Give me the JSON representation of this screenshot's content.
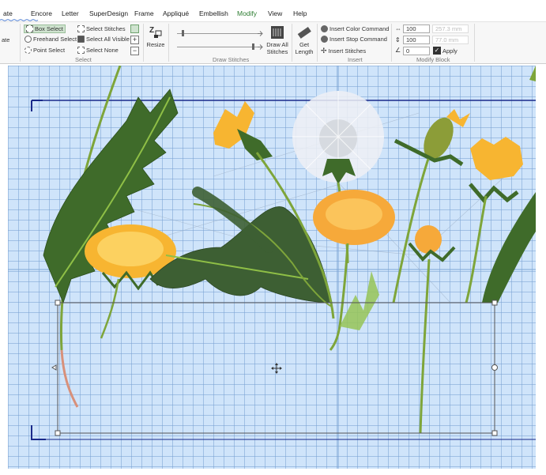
{
  "tabs": [
    {
      "label": "ate",
      "active": false
    },
    {
      "label": "Encore",
      "active": false
    },
    {
      "label": "Letter",
      "active": false
    },
    {
      "label": "SuperDesign",
      "active": false
    },
    {
      "label": "Frame",
      "active": false
    },
    {
      "label": "Appliqué",
      "active": false
    },
    {
      "label": "Embellish",
      "active": false
    },
    {
      "label": "Modify",
      "active": true
    },
    {
      "label": "View",
      "active": false
    },
    {
      "label": "Help",
      "active": false
    }
  ],
  "ribbon": {
    "left_partial_label": "ate",
    "select": {
      "box_select": "Box Select",
      "freehand_select": "Freehand Select",
      "point_select": "Point Select",
      "select_stitches": "Select Stitches",
      "select_all_visible": "Select All Visible",
      "select_none": "Select None",
      "group_label": "Select"
    },
    "resize": {
      "label": "Resize"
    },
    "draw_stitches": {
      "draw_all_label": "Draw All Stitches",
      "group_label": "Draw Stitches"
    },
    "get_length": {
      "label": "Get Length"
    },
    "insert": {
      "insert_color_command": "Insert Color Command",
      "insert_stop_command": "Insert Stop Command",
      "insert_stitches": "Insert Stitches",
      "group_label": "Insert"
    },
    "modify_block": {
      "width_pct": "100",
      "width_mm": "257.3 mm",
      "height_pct": "100",
      "height_mm": "77.0 mm",
      "angle": "0",
      "apply_label": "Apply",
      "apply_checked": true,
      "group_label": "Modify Block"
    }
  },
  "colors": {
    "canvas_bg": "#cfe4fa",
    "grid": "#8fb4dc",
    "accent_green": "#2e7d32",
    "selection_box": "#555555",
    "hoop": "#1a2a8a",
    "leaf": "#3f6b2a",
    "stem": "#7ea53a",
    "flower": "#f7b531",
    "seed_head": "#e6e9ee"
  }
}
